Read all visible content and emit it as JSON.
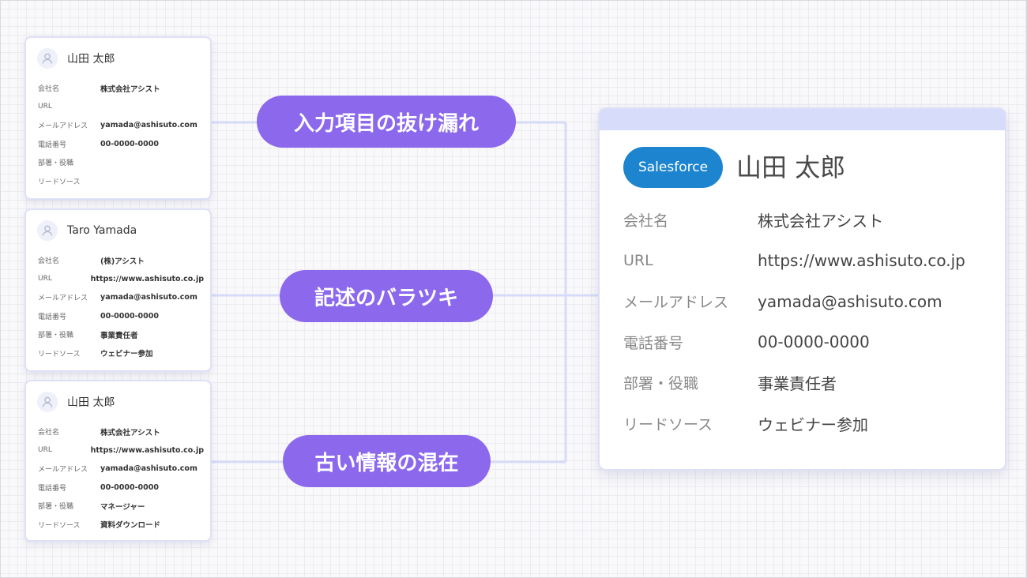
{
  "cards": [
    {
      "name": "山田 太郎",
      "fields": [
        {
          "label": "会社名",
          "value": "株式会社アシスト"
        },
        {
          "label": "URL",
          "value": ""
        },
        {
          "label": "メールアドレス",
          "value": "yamada@ashisuto.com"
        },
        {
          "label": "電話番号",
          "value": "00-0000-0000"
        },
        {
          "label": "部署・役職",
          "value": ""
        },
        {
          "label": "リードソース",
          "value": ""
        }
      ]
    },
    {
      "name": "Taro Yamada",
      "fields": [
        {
          "label": "会社名",
          "value": "(株)アシスト"
        },
        {
          "label": "URL",
          "value": "https://www.ashisuto.co.jp"
        },
        {
          "label": "メールアドレス",
          "value": "yamada@ashisuto.com"
        },
        {
          "label": "電話番号",
          "value": "00-0000-0000"
        },
        {
          "label": "部署・役職",
          "value": "事業責任者"
        },
        {
          "label": "リードソース",
          "value": "ウェビナー参加"
        }
      ]
    },
    {
      "name": "山田 太郎",
      "fields": [
        {
          "label": "会社名",
          "value": "株式会社アシスト"
        },
        {
          "label": "URL",
          "value": "https://www.ashisuto.co.jp"
        },
        {
          "label": "メールアドレス",
          "value": "yamada@ashisuto.com"
        },
        {
          "label": "電話番号",
          "value": "00-0000-0000"
        },
        {
          "label": "部署・役職",
          "value": "マネージャー"
        },
        {
          "label": "リードソース",
          "value": "資料ダウンロード"
        }
      ]
    }
  ],
  "issues": [
    "入力項目の抜け漏れ",
    "記述のバラツキ",
    "古い情報の混在"
  ],
  "salesforce": {
    "badge": "Salesforce",
    "name": "山田 太郎",
    "fields": [
      {
        "label": "会社名",
        "value": "株式会社アシスト"
      },
      {
        "label": "URL",
        "value": "https://www.ashisuto.co.jp"
      },
      {
        "label": "メールアドレス",
        "value": "yamada@ashisuto.com"
      },
      {
        "label": "電話番号",
        "value": "00-0000-0000"
      },
      {
        "label": "部署・役職",
        "value": "事業責任者"
      },
      {
        "label": "リードソース",
        "value": "ウェビナー参加"
      }
    ]
  },
  "colors": {
    "pill": "#8b68ec",
    "salesforce_badge": "#1d85cf",
    "connector": "#d6dcf8",
    "card_border": "#dde0f7",
    "sf_header": "#d6dcfa"
  },
  "icons": [
    "user-avatar-icon"
  ]
}
